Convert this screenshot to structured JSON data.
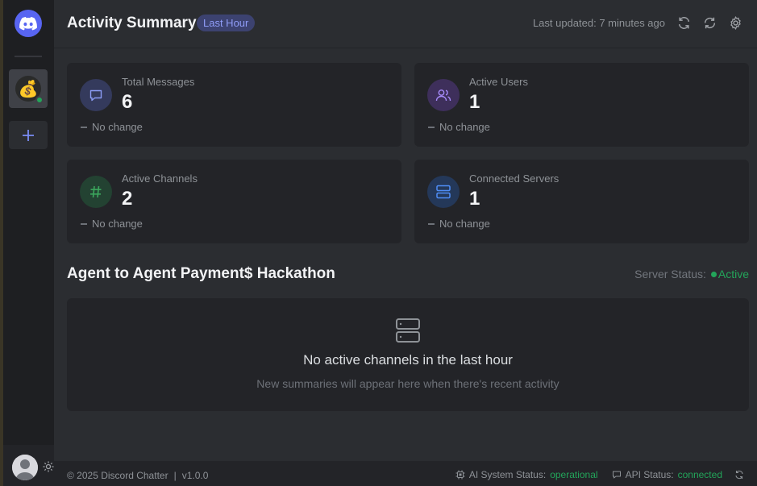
{
  "header": {
    "title": "Activity Summary",
    "range_badge": "Last Hour",
    "last_updated": "Last updated: 7 minutes ago"
  },
  "rail": {
    "server_avatar_emoji": "💰",
    "add_label": "+"
  },
  "stats": [
    {
      "label": "Total Messages",
      "value": "6",
      "change": "No change",
      "icon": "message-icon",
      "color": "#8b9cf5"
    },
    {
      "label": "Active Users",
      "value": "1",
      "change": "No change",
      "icon": "users-icon",
      "color": "#a78bfa"
    },
    {
      "label": "Active Channels",
      "value": "2",
      "change": "No change",
      "icon": "hash-icon",
      "color": "#3ba55c"
    },
    {
      "label": "Connected Servers",
      "value": "1",
      "change": "No change",
      "icon": "server-icon",
      "color": "#4f8ef7"
    }
  ],
  "server": {
    "name": "Agent to Agent Payment$ Hackathon",
    "status_label": "Server Status:",
    "status_value": "Active"
  },
  "empty_state": {
    "title": "No active channels in the last hour",
    "subtitle": "New summaries will appear here when there's recent activity"
  },
  "footer": {
    "copyright": "© 2025 Discord Chatter",
    "separator": "|",
    "version": "v1.0.0",
    "ai_status_label": "AI System Status:",
    "ai_status_value": "operational",
    "api_status_label": "API Status:",
    "api_status_value": "connected"
  },
  "colors": {
    "accent": "#5865f2",
    "success": "#23a55a",
    "badge_bg": "#3c4270"
  }
}
